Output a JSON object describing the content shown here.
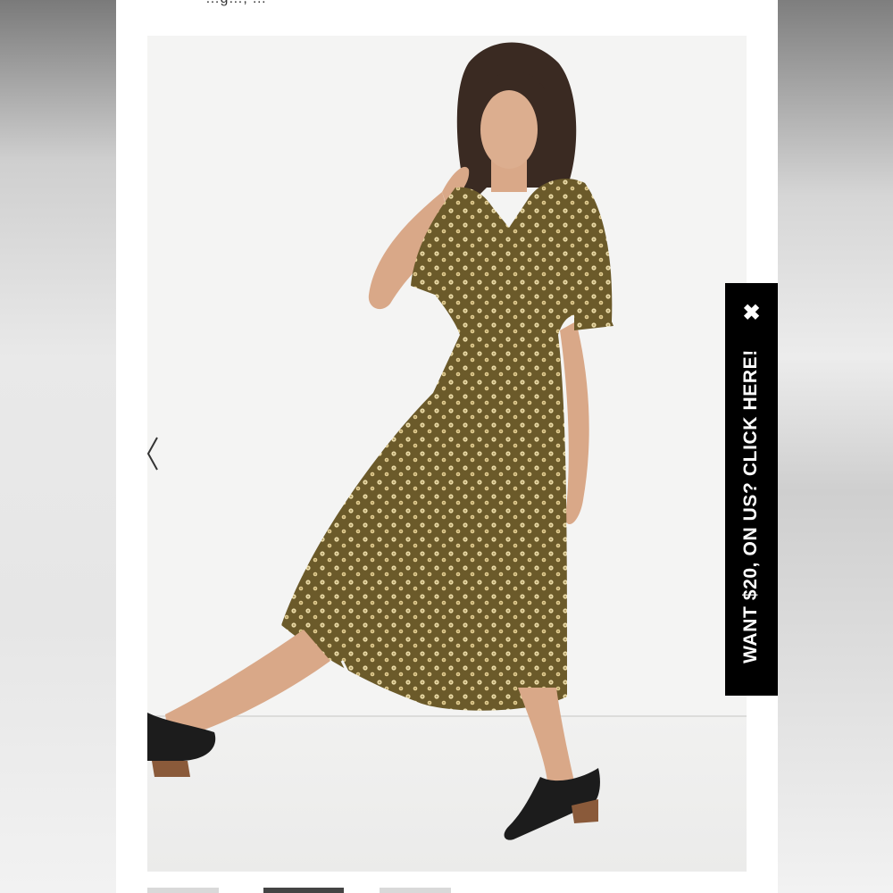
{
  "header": {
    "partial_text": "…g…, …"
  },
  "gallery": {
    "image_alt": "Model wearing olive floral print midi dress with black mules",
    "prev_icon": "chevron-left-icon",
    "thumbnails_count": 3,
    "active_thumbnail": 2
  },
  "promo": {
    "label": "WANT $20, ON US? CLICK HERE!",
    "close_symbol": "✖",
    "close_icon": "close-icon",
    "background": "#000000",
    "text_color": "#ffffff"
  },
  "colors": {
    "dress": "#6b5a2a",
    "print": "#e9d9a6",
    "skin": "#d9a888",
    "hair": "#3a2a22",
    "shoe": "#1c1c1c"
  }
}
